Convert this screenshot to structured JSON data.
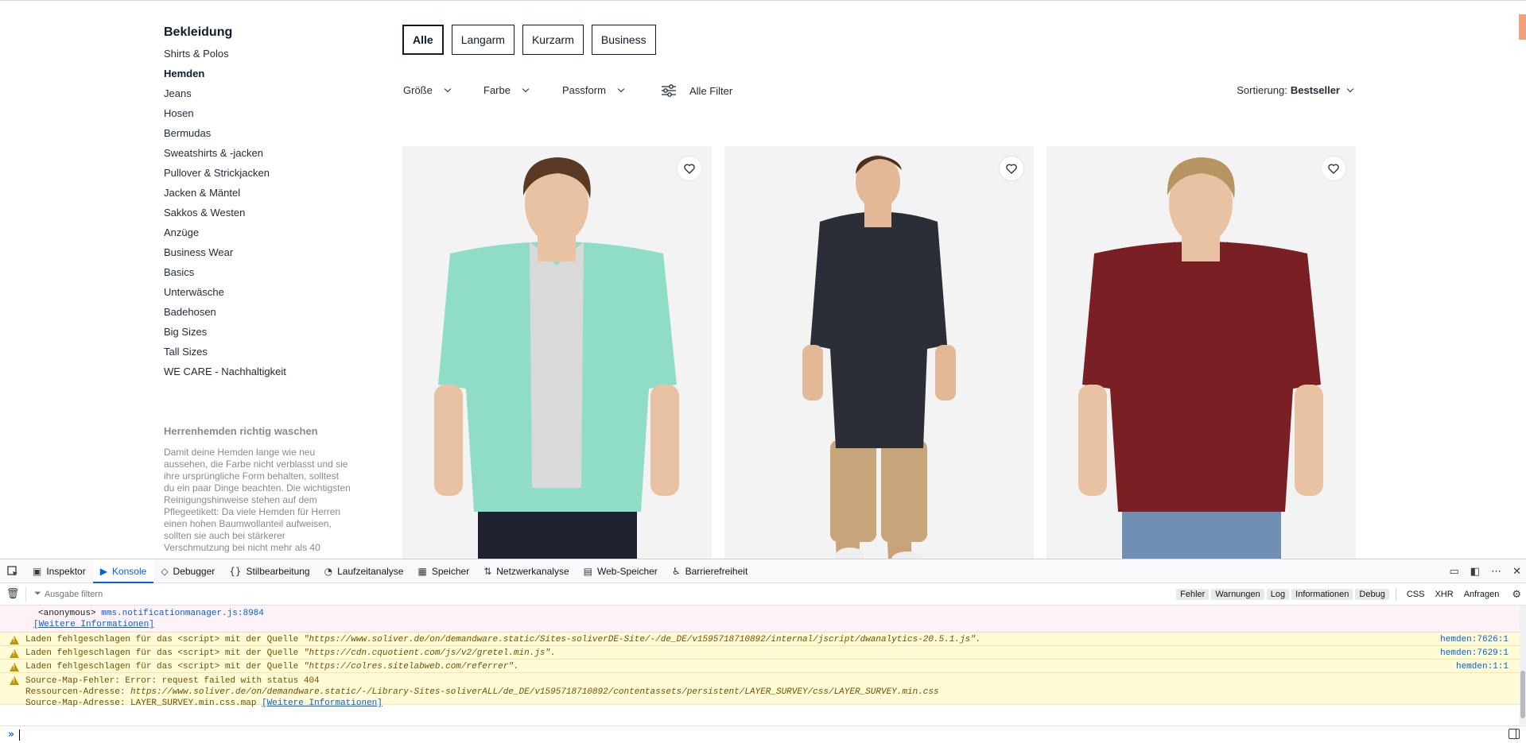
{
  "sidebar": {
    "heading": "Bekleidung",
    "categories": [
      {
        "label": "Shirts & Polos",
        "active": false
      },
      {
        "label": "Hemden",
        "active": true
      },
      {
        "label": "Jeans",
        "active": false
      },
      {
        "label": "Hosen",
        "active": false
      },
      {
        "label": "Bermudas",
        "active": false
      },
      {
        "label": "Sweatshirts & -jacken",
        "active": false
      },
      {
        "label": "Pullover & Strickjacken",
        "active": false
      },
      {
        "label": "Jacken & Mäntel",
        "active": false
      },
      {
        "label": "Sakkos & Westen",
        "active": false
      },
      {
        "label": "Anzüge",
        "active": false
      },
      {
        "label": "Business Wear",
        "active": false
      },
      {
        "label": "Basics",
        "active": false
      },
      {
        "label": "Unterwäsche",
        "active": false
      },
      {
        "label": "Badehosen",
        "active": false
      },
      {
        "label": "Big Sizes",
        "active": false
      },
      {
        "label": "Tall Sizes",
        "active": false
      },
      {
        "label": "WE CARE - Nachhaltigkeit",
        "active": false
      }
    ],
    "care_title": "Herrenhemden richtig waschen",
    "care_text": "Damit deine Hemden lange wie neu aussehen, die Farbe nicht verblasst und sie ihre ursprüngliche Form behalten, solltest du ein paar Dinge beachten. Die wichtigsten Reinigungshinweise stehen auf dem Pflegeetikett: Da viele Hemden für Herren einen hohen Baumwollanteil aufweisen, sollten sie auch bei stärkerer Verschmutzung bei nicht mehr als 40"
  },
  "chips": [
    {
      "label": "Alle",
      "active": true
    },
    {
      "label": "Langarm",
      "active": false
    },
    {
      "label": "Kurzarm",
      "active": false
    },
    {
      "label": "Business",
      "active": false
    }
  ],
  "filters": {
    "size": "Größe",
    "color": "Farbe",
    "fit": "Passform",
    "all": "Alle Filter",
    "sort_label": "Sortierung:",
    "sort_value": "Bestseller"
  },
  "products": [
    {
      "shirt_color": "#8fdcc8",
      "inner_color": "#d9d9d9",
      "pants_color": "#1e2230",
      "hair_color": "#5a3a24"
    },
    {
      "shirt_color": "#2b2e36",
      "inner_color": "#2b2e36",
      "pants_color": "#c8a57a",
      "hair_color": "#4a2e1e"
    },
    {
      "shirt_color": "#7a1f24",
      "inner_color": "#7a1f24",
      "pants_color": "#6f8fb3",
      "hair_color": "#b89462"
    }
  ],
  "devtools": {
    "tabs": [
      {
        "label": "Inspektor",
        "icon": "inspector-icon",
        "glyph": "▣",
        "active": false
      },
      {
        "label": "Konsole",
        "icon": "console-icon",
        "glyph": "▶",
        "active": true
      },
      {
        "label": "Debugger",
        "icon": "debugger-icon",
        "glyph": "◇",
        "active": false
      },
      {
        "label": "Stilbearbeitung",
        "icon": "style-editor-icon",
        "glyph": "{}",
        "active": false
      },
      {
        "label": "Laufzeitanalyse",
        "icon": "performance-icon",
        "glyph": "◔",
        "active": false
      },
      {
        "label": "Speicher",
        "icon": "memory-icon",
        "glyph": "▦",
        "active": false
      },
      {
        "label": "Netzwerkanalyse",
        "icon": "network-icon",
        "glyph": "⇅",
        "active": false
      },
      {
        "label": "Web-Speicher",
        "icon": "storage-icon",
        "glyph": "▤",
        "active": false
      },
      {
        "label": "Barrierefreiheit",
        "icon": "accessibility-icon",
        "glyph": "♿",
        "active": false
      }
    ],
    "filter_placeholder": "Ausgabe filtern",
    "levels": [
      "Fehler",
      "Warnungen",
      "Log",
      "Informationen",
      "Debug"
    ],
    "extra_filters": [
      "CSS",
      "XHR",
      "Anfragen"
    ],
    "error_entry": {
      "stack_prefix": "<anonymous>",
      "stack_source": "mms.notificationmanager.js:8984",
      "more_info": "[Weitere Informationen]"
    },
    "warnings": [
      {
        "prefix": "Laden fehlgeschlagen für das <script> mit der Quelle ",
        "url": "\"https://www.soliver.de/on/demandware.static/Sites-soliverDE-Site/-/de_DE/v1595718710892/internal/jscript/dwanalytics-20.5.1.js\".",
        "source": "hemden:7626:1"
      },
      {
        "prefix": "Laden fehlgeschlagen für das <script> mit der Quelle ",
        "url": "\"https://cdn.cquotient.com/js/v2/gretel.min.js\".",
        "source": "hemden:7629:1"
      },
      {
        "prefix": "Laden fehlgeschlagen für das <script> mit der Quelle ",
        "url": "\"https://colres.sitelabweb.com/referrer\".",
        "source": "hemden:1:1"
      }
    ],
    "sourcemap": {
      "line1": "Source-Map-Fehler: Error: request failed with status 404",
      "line2_prefix": "Ressourcen-Adresse: ",
      "line2_url": "https://www.soliver.de/on/demandware.static/-/Library-Sites-soliverALL/de_DE/v1595718710892/contentassets/persistent/LAYER_SURVEY/css/LAYER_SURVEY.min.css",
      "line3_prefix": "Source-Map-Adresse: LAYER_SURVEY.min.css.map ",
      "line3_link": "[Weitere Informationen]"
    },
    "prompt": "»"
  }
}
